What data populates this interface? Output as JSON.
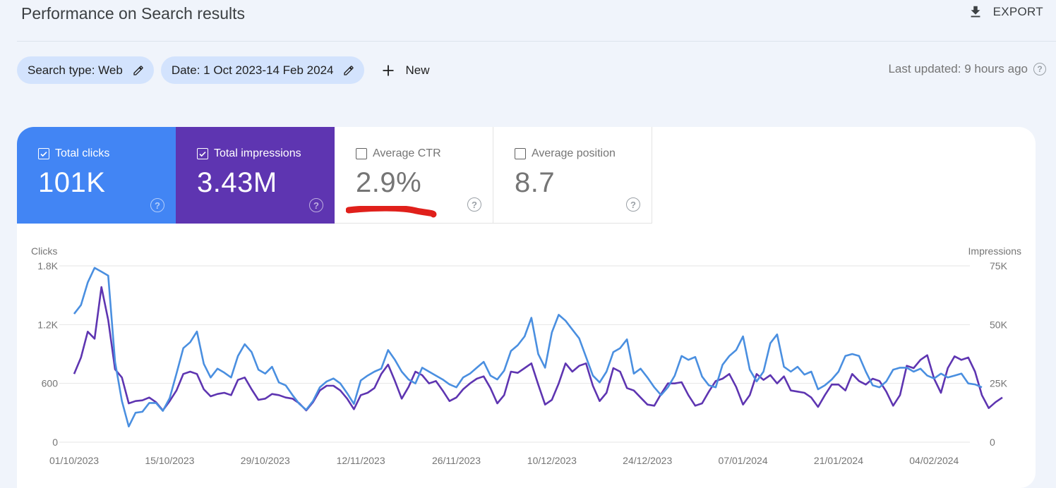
{
  "header": {
    "title": "Performance on Search results",
    "export_label": "EXPORT"
  },
  "filters": {
    "search_type": "Search type: Web",
    "date": "Date: 1 Oct 2023-14 Feb 2024",
    "new_label": "New",
    "last_updated": "Last updated: 9 hours ago"
  },
  "metrics": [
    {
      "label": "Total clicks",
      "value": "101K",
      "checked": true,
      "color": "#4285f4"
    },
    {
      "label": "Total impressions",
      "value": "3.43M",
      "checked": true,
      "color": "#5e35b1"
    },
    {
      "label": "Average CTR",
      "value": "2.9%",
      "checked": false
    },
    {
      "label": "Average position",
      "value": "8.7",
      "checked": false
    }
  ],
  "annotation": {
    "color": "#e0201b",
    "target": "Average CTR"
  },
  "chart_data": {
    "type": "line",
    "title": "",
    "left_axis_label": "Clicks",
    "right_axis_label": "Impressions",
    "left_ticks": [
      "0",
      "600",
      "1.2K",
      "1.8K"
    ],
    "left_ylim": [
      0,
      1800
    ],
    "right_ticks": [
      "0",
      "25K",
      "50K",
      "75K"
    ],
    "right_ylim": [
      0,
      75000
    ],
    "x_tick_labels": [
      "01/10/2023",
      "15/10/2023",
      "29/10/2023",
      "12/11/2023",
      "26/11/2023",
      "10/12/2023",
      "24/12/2023",
      "07/01/2024",
      "21/01/2024",
      "04/02/2024"
    ],
    "x_start": "01/10/2023",
    "x_end": "14/02/2024",
    "grid": true,
    "series": [
      {
        "name": "Clicks",
        "axis": "left",
        "color": "#4a8fe0",
        "values": [
          1310,
          1400,
          1630,
          1780,
          1740,
          1700,
          820,
          420,
          160,
          300,
          310,
          400,
          400,
          320,
          450,
          700,
          960,
          1020,
          1130,
          800,
          660,
          750,
          710,
          660,
          880,
          1000,
          920,
          740,
          700,
          770,
          610,
          580,
          480,
          390,
          330,
          420,
          560,
          620,
          650,
          600,
          500,
          390,
          630,
          680,
          720,
          750,
          940,
          840,
          720,
          640,
          600,
          760,
          720,
          680,
          640,
          590,
          560,
          660,
          700,
          760,
          820,
          680,
          640,
          730,
          930,
          990,
          1080,
          1270,
          900,
          760,
          1120,
          1300,
          1240,
          1150,
          1060,
          870,
          680,
          610,
          720,
          920,
          960,
          1050,
          700,
          750,
          660,
          560,
          480,
          560,
          680,
          880,
          840,
          870,
          670,
          580,
          560,
          790,
          880,
          940,
          1080,
          740,
          620,
          720,
          1010,
          1100,
          770,
          720,
          770,
          690,
          720,
          540,
          580,
          640,
          720,
          880,
          900,
          880,
          720,
          580,
          560,
          620,
          740,
          760,
          760,
          720,
          750,
          680,
          650,
          700,
          660,
          680,
          700,
          600,
          590,
          560
        ]
      },
      {
        "name": "Impressions",
        "axis": "right",
        "color": "#5e35b1",
        "values": [
          29000,
          36000,
          47000,
          44000,
          66000,
          52000,
          31000,
          27500,
          16500,
          17500,
          17800,
          19000,
          17000,
          13500,
          17500,
          22000,
          29000,
          30000,
          29000,
          22500,
          19500,
          20500,
          21000,
          20000,
          26500,
          27500,
          22500,
          18000,
          18500,
          20500,
          20000,
          19000,
          18500,
          16500,
          13500,
          17000,
          22000,
          24000,
          24000,
          22000,
          18500,
          14000,
          20000,
          21000,
          23000,
          29000,
          33000,
          26000,
          18500,
          23500,
          30000,
          28500,
          25000,
          26000,
          22000,
          17500,
          19000,
          22500,
          25000,
          27000,
          28000,
          23000,
          16500,
          20000,
          30000,
          29500,
          31500,
          33500,
          24500,
          16000,
          18000,
          25000,
          33500,
          30000,
          32500,
          33500,
          24000,
          17500,
          21000,
          31500,
          30000,
          23000,
          22000,
          19000,
          16000,
          15500,
          20500,
          25000,
          25000,
          25500,
          20000,
          15500,
          16500,
          21500,
          26000,
          27000,
          29000,
          23500,
          16000,
          20000,
          29000,
          26500,
          28500,
          25000,
          28000,
          22000,
          21500,
          21000,
          19000,
          15000,
          20000,
          24500,
          24500,
          22000,
          29000,
          26000,
          24500,
          27000,
          26000,
          21500,
          15500,
          20000,
          32500,
          31500,
          35000,
          37000,
          27000,
          21000,
          31500,
          36500,
          35000,
          36000,
          30000,
          20000,
          14500,
          17000,
          19000
        ]
      }
    ]
  }
}
